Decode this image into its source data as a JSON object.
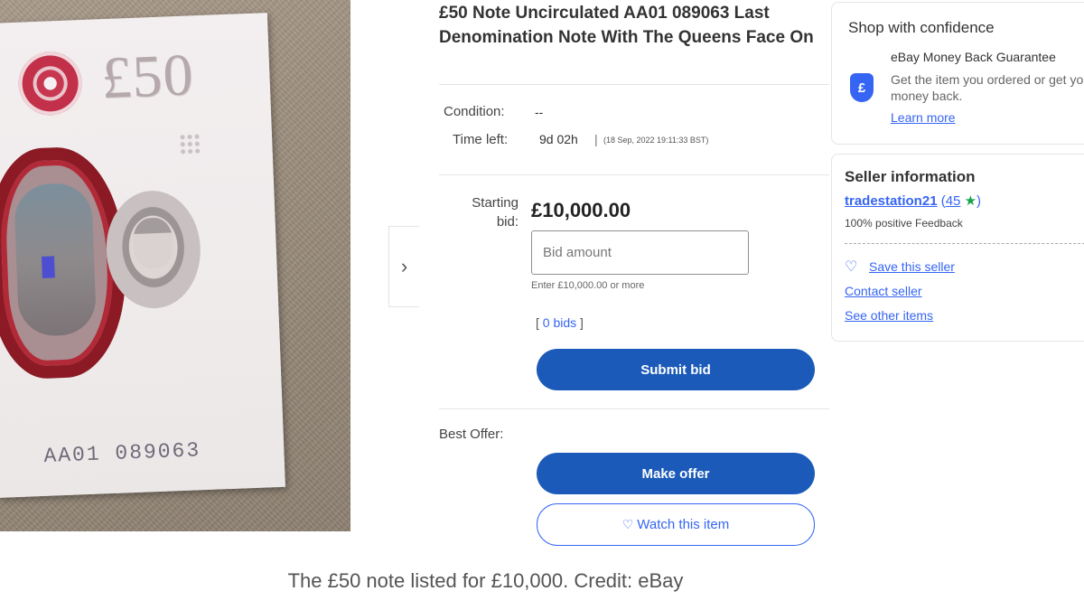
{
  "photo": {
    "denomination": "£50",
    "serial_number": "AA01 089063"
  },
  "listing": {
    "title": "£50 Note Uncirculated AA01 089063 Last Denomination Note With The Queens Face On",
    "condition_label": "Condition:",
    "condition_value": "--",
    "time_left_label": "Time left:",
    "time_left_value": "9d 02h",
    "time_left_separator": "|",
    "time_left_date": "(18 Sep, 2022 19:11:33 BST)",
    "starting_bid_label_1": "Starting",
    "starting_bid_label_2": "bid:",
    "starting_bid_value": "£10,000.00",
    "bid_input_placeholder": "Bid amount",
    "bid_hint": "Enter £10,000.00 or more",
    "bids_open": "[",
    "bids_link": "0 bids",
    "bids_close": "]",
    "submit_bid": "Submit bid",
    "best_offer_label": "Best Offer:",
    "make_offer": "Make offer",
    "watch_item": "Watch this item"
  },
  "shop_confidence": {
    "heading": "Shop with confidence",
    "guarantee_title": "eBay Money Back Guarantee",
    "guarantee_text": "Get the item you ordered or get your money back.",
    "learn_more": "Learn more",
    "shield_glyph": "£"
  },
  "seller": {
    "heading": "Seller information",
    "name": "tradestation21",
    "feedback_score_open": "(",
    "feedback_score": "45",
    "feedback_star": "★",
    "feedback_score_close": ")",
    "feedback_text": "100% positive Feedback",
    "save_seller": "Save this seller",
    "contact_seller": "Contact seller",
    "see_other_items": "See other items"
  },
  "carousel": {
    "next_glyph": "›"
  },
  "caption": "The £50 note listed for £10,000. Credit: eBay",
  "colors": {
    "ebay_blue": "#3665f3",
    "button_blue": "#1b5ab8",
    "note_red": "#8b1a25"
  }
}
